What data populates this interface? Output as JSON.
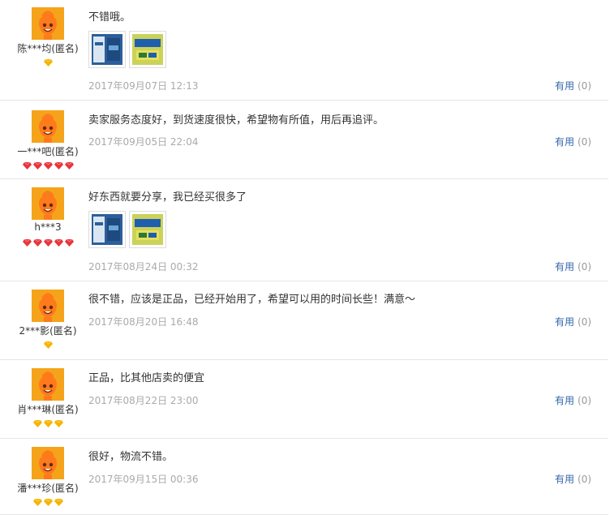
{
  "reviews": [
    {
      "user": "陈***均(匿名)",
      "rank": "diamond-yellow-1",
      "text": "不错哦。",
      "photos": [
        "photo-1",
        "photo-2"
      ],
      "date": "2017年09月07日 12:13",
      "useful_label": "有用",
      "useful_count": "(0)"
    },
    {
      "user": "一***吧(匿名)",
      "rank": "diamond-red-5",
      "text": "卖家服务态度好，到货速度很快，希望物有所值，用后再追评。",
      "photos": [],
      "date": "2017年09月05日 22:04",
      "useful_label": "有用",
      "useful_count": "(0)"
    },
    {
      "user": "h***3",
      "rank": "diamond-red-5",
      "text": "好东西就要分享，我已经买很多了",
      "photos": [
        "photo-1",
        "photo-2"
      ],
      "date": "2017年08月24日 00:32",
      "useful_label": "有用",
      "useful_count": "(0)"
    },
    {
      "user": "2***影(匿名)",
      "rank": "diamond-yellow-1",
      "text": "很不错，应该是正品，已经开始用了，希望可以用的时间长些！满意～",
      "photos": [],
      "date": "2017年08月20日 16:48",
      "useful_label": "有用",
      "useful_count": "(0)"
    },
    {
      "user": "肖***琳(匿名)",
      "rank": "diamond-yellow-3",
      "text": "正品，比其他店卖的便宜",
      "photos": [],
      "date": "2017年08月22日 23:00",
      "useful_label": "有用",
      "useful_count": "(0)"
    },
    {
      "user": "潘***珍(匿名)",
      "rank": "diamond-yellow-3",
      "text": "很好，物流不错。",
      "photos": [],
      "date": "2017年09月15日 00:36",
      "useful_label": "有用",
      "useful_count": "(0)"
    }
  ],
  "colors": {
    "avatar_bg": "#f5a31a",
    "useful_link": "#3366aa",
    "date": "#aaaaaa",
    "rank_yellow": "#f6b400",
    "rank_red": "#e8343c"
  }
}
